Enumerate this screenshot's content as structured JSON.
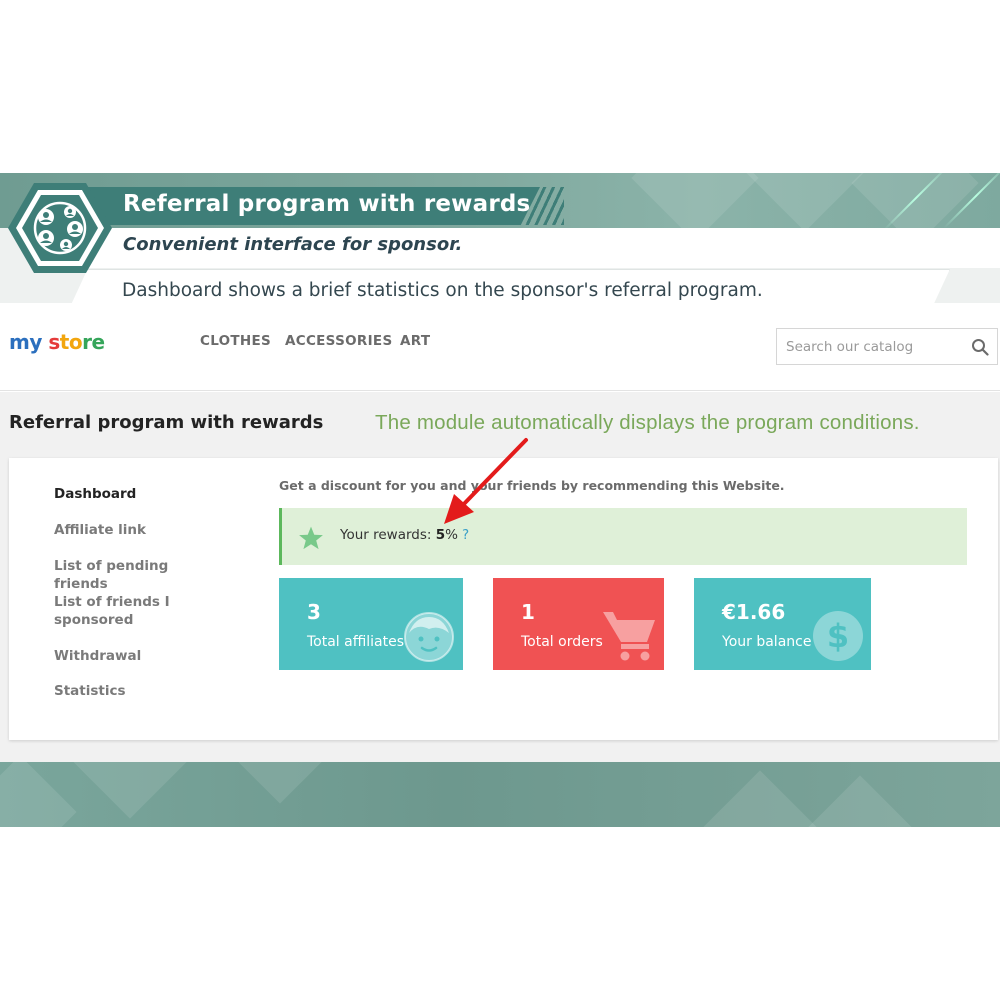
{
  "banner": {
    "title": "Referral program with rewards",
    "subtitle": "Convenient interface for sponsor.",
    "description": "Dashboard shows a brief statistics on the sponsor's referral program.",
    "logo_icon": "referral-network-icon",
    "accent_color": "#3e7e78"
  },
  "header": {
    "logo": {
      "part1": "my",
      "part2": " s",
      "part3": "to",
      "part4": "re"
    },
    "nav": [
      "CLOTHES",
      "ACCESSORIES",
      "ART"
    ],
    "search_placeholder": "Search our catalog",
    "search_icon": "search-icon"
  },
  "page": {
    "title": "Referral program with rewards",
    "annotation": "The module automatically displays the program conditions."
  },
  "sidebar": {
    "items": [
      {
        "label": "Dashboard",
        "active": true
      },
      {
        "label": "Affiliate link",
        "active": false
      },
      {
        "label": "List of pending friends",
        "active": false
      },
      {
        "label": "List of friends I sponsored",
        "active": false
      },
      {
        "label": "Withdrawal",
        "active": false
      },
      {
        "label": "Statistics",
        "active": false
      }
    ]
  },
  "main": {
    "intro": "Get a discount for you and your friends by recommending this Website.",
    "rewards": {
      "label": "Your rewards: ",
      "value": "5",
      "unit": "%",
      "help": "?"
    },
    "stats": [
      {
        "value": "3",
        "label": "Total affiliates",
        "icon": "face-icon",
        "color": "#4fc1c2"
      },
      {
        "value": "1",
        "label": "Total orders",
        "icon": "cart-icon",
        "color": "#f05253"
      },
      {
        "value": "€1.66",
        "label": "Your balance",
        "icon": "dollar-icon",
        "color": "#4fc1c2"
      }
    ]
  },
  "colors": {
    "success_bg": "#dff0d8",
    "success_accent": "#5cb85c",
    "annotation_green": "#7aa85a",
    "arrow_red": "#e31b1b"
  }
}
